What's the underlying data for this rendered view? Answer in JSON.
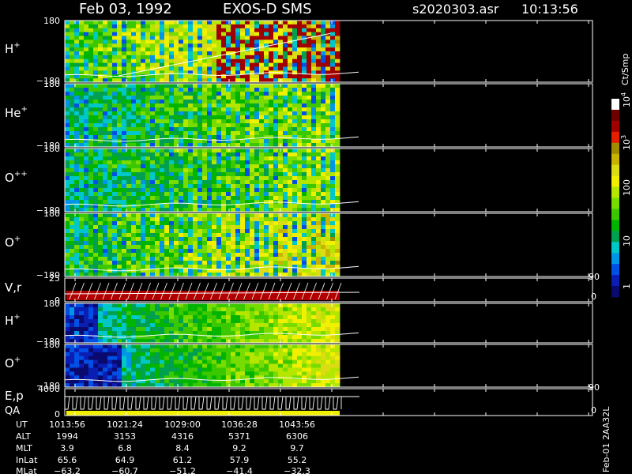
{
  "header": {
    "date": "Feb 03, 1992",
    "mission": "EXOS-D SMS",
    "file": "s2020303.asr",
    "time": "10:13:56"
  },
  "chart_data": {
    "type": "heatmap",
    "colorbar": {
      "label": "Ct/Smp",
      "ticks": [
        "1",
        "10",
        "100",
        "10",
        "10"
      ],
      "tick_exponents": [
        "",
        "",
        "",
        "3",
        "4"
      ],
      "tick_values": [
        1,
        10,
        100,
        1000,
        10000
      ],
      "colors": [
        "#0a0a6e",
        "#0a1eb4",
        "#0050e6",
        "#0096e6",
        "#00c8c8",
        "#00a050",
        "#00b400",
        "#3cc800",
        "#78dc00",
        "#b4e600",
        "#f0f000",
        "#dcdc14",
        "#c8b400",
        "#a08c00",
        "#e61e00",
        "#a00000",
        "#6e0000",
        "#ffffff"
      ]
    },
    "panels": [
      {
        "label": "H",
        "charge": "+",
        "ymax": "180",
        "ymin": "−180",
        "type": "spectrogram"
      },
      {
        "label": "He",
        "charge": "+",
        "ymax": "180",
        "ymin": "−180",
        "type": "spectrogram"
      },
      {
        "label": "O",
        "charge": "++",
        "ymax": "180",
        "ymin": "−180",
        "type": "spectrogram"
      },
      {
        "label": "O",
        "charge": "+",
        "ymax": "180",
        "ymin": "−180",
        "type": "spectrogram"
      },
      {
        "label": "V,r",
        "charge": "",
        "ymax": "25",
        "ymin": "0",
        "type": "line",
        "right_top": "90",
        "right_bottom": "0"
      },
      {
        "label": "H",
        "charge": "+",
        "ymax": "180",
        "ymin": "−180",
        "type": "spectrogram"
      },
      {
        "label": "O",
        "charge": "+",
        "ymax": "180",
        "ymin": "−180",
        "type": "spectrogram"
      },
      {
        "label": "E,p",
        "label2": "QA",
        "charge": "",
        "ymax": "4000",
        "ymin": "0",
        "type": "line",
        "right_top": "90",
        "right_bottom": "0"
      }
    ],
    "ephemeris": {
      "row_labels": [
        "UT",
        "ALT",
        "MLT",
        "InLat",
        "MLat"
      ],
      "columns": [
        [
          "1013:56",
          "1994",
          "3.9",
          "65.6",
          "−63.2"
        ],
        [
          "1021:24",
          "3153",
          "6.8",
          "64.9",
          "−60.7"
        ],
        [
          "1029:00",
          "4316",
          "8.4",
          "61.2",
          "−51.2"
        ],
        [
          "1036:28",
          "5371",
          "9.2",
          "57.9",
          "−41.4"
        ],
        [
          "1043:56",
          "6306",
          "9.7",
          "55.2",
          "−32.3"
        ]
      ]
    },
    "footer_id": "Feb-01 2AA32L"
  }
}
